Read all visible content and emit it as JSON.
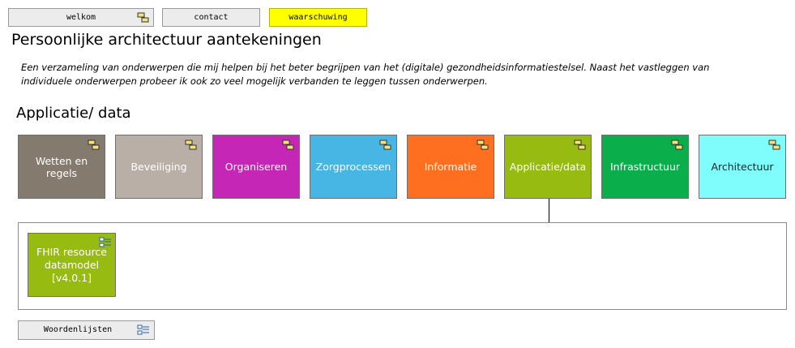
{
  "nav": {
    "welkom": "welkom",
    "contact": "contact",
    "waarschuwing": "waarschuwing"
  },
  "page_title": "Persoonlijke architectuur aantekeningen",
  "intro": "Een verzameling van onderwerpen die mij helpen bij het beter begrijpen van het (digitale) gezondheidsinformatiestelsel. Naast het vastleggen van individuele onderwerpen probeer ik ook zo veel mogelijk verbanden te leggen tussen onderwerpen.",
  "section_title": "Applicatie/ data",
  "tiles": [
    {
      "label": "Wetten en regels",
      "color": "#857a6e",
      "icon": "package-icon"
    },
    {
      "label": "Beveiliging",
      "color": "#b9afa7",
      "icon": "package-icon"
    },
    {
      "label": "Organiseren",
      "color": "#c526b5",
      "icon": "package-icon"
    },
    {
      "label": "Zorgprocessen",
      "color": "#47b6e4",
      "icon": "package-icon"
    },
    {
      "label": "Informatie",
      "color": "#ff6f1f",
      "icon": "package-icon"
    },
    {
      "label": "Applicatie/data",
      "color": "#97bb11",
      "icon": "package-icon"
    },
    {
      "label": "Infrastructuur",
      "color": "#0aaf4b",
      "icon": "package-icon"
    },
    {
      "label": "Architectuur",
      "color": "#7ffcfc",
      "icon": "package-icon"
    }
  ],
  "fhir": {
    "line1": "FHIR resource",
    "line2": "datamodel",
    "line3": "[v4.0.1]",
    "icon": "element-list-icon"
  },
  "wordlists": {
    "label": "Woordenlijsten",
    "icon": "element-list-icon"
  }
}
